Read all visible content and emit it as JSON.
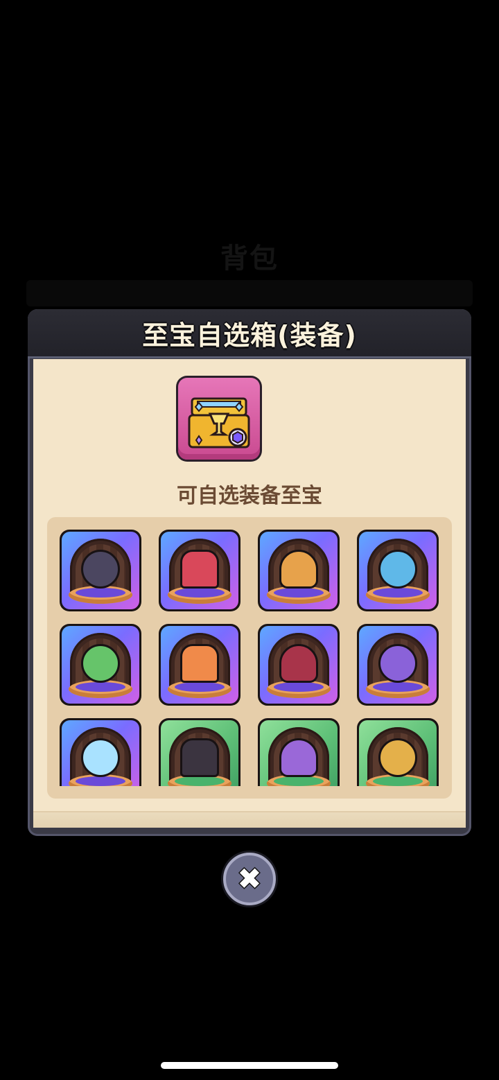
{
  "background": {
    "title": "背包"
  },
  "dialog": {
    "title": "至宝自选箱(装备)",
    "subtitle": "可自选装备至宝",
    "chest_icon": "treasure-chest-icon"
  },
  "items": [
    {
      "name": "dark-armor-icon",
      "rarity": "purple",
      "color": "#4b4660"
    },
    {
      "name": "red-cloak-icon",
      "rarity": "purple",
      "color": "#d9485a"
    },
    {
      "name": "gold-wing-ring-icon",
      "rarity": "purple",
      "color": "#e7a24b"
    },
    {
      "name": "blue-crystal-ring-icon",
      "rarity": "purple",
      "color": "#5fb8e8"
    },
    {
      "name": "green-gem-ring-icon",
      "rarity": "purple",
      "color": "#66c46a"
    },
    {
      "name": "orange-gem-badge-icon",
      "rarity": "purple",
      "color": "#f08a4a"
    },
    {
      "name": "bat-wing-chalice-icon",
      "rarity": "purple",
      "color": "#a8344a"
    },
    {
      "name": "sword-shield-icon",
      "rarity": "purple",
      "color": "#8a62d9"
    },
    {
      "name": "ice-crystal-icon",
      "rarity": "purple",
      "color": "#a9e2ff"
    },
    {
      "name": "red-armor-icon",
      "rarity": "green",
      "color": "#3b3440"
    },
    {
      "name": "purple-cloak-icon",
      "rarity": "green",
      "color": "#9a68d8"
    },
    {
      "name": "purple-gem-ring-icon",
      "rarity": "green",
      "color": "#e4b04a"
    }
  ],
  "close_button": {
    "icon": "close-icon",
    "label": "✖"
  }
}
